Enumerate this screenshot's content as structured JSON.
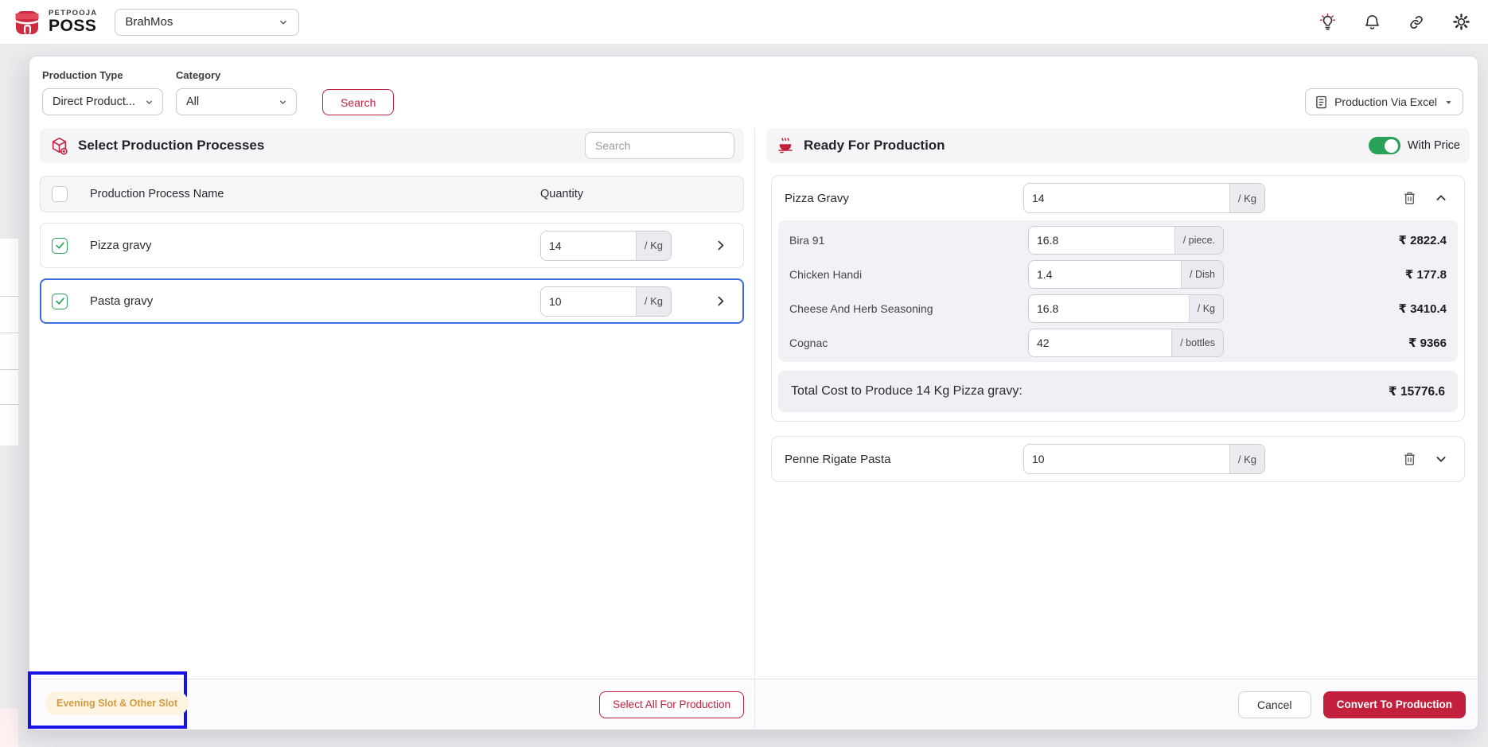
{
  "topbar": {
    "brand": {
      "top": "PETPOOJA",
      "bottom": "POSS"
    },
    "outlet": {
      "value": "BrahMos"
    }
  },
  "filters": {
    "production_type_label": "Production Type",
    "production_type_value": "Direct Product...",
    "category_label": "Category",
    "category_value": "All",
    "search_button": "Search",
    "excel_button": "Production Via Excel"
  },
  "left_panel": {
    "title": "Select Production Processes",
    "search_placeholder": "Search",
    "columns": {
      "name": "Production Process Name",
      "qty": "Quantity"
    },
    "rows": [
      {
        "name": "Pizza gravy",
        "qty": "14",
        "unit": "/ Kg"
      },
      {
        "name": "Pasta gravy",
        "qty": "10",
        "unit": "/ Kg"
      }
    ],
    "slot_badge": "Evening Slot & Other Slot",
    "select_all_button": "Select All For Production"
  },
  "right_panel": {
    "title": "Ready For Production",
    "with_price_label": "With Price",
    "cards": [
      {
        "name": "Pizza Gravy",
        "qty": "14",
        "unit": "/ Kg",
        "ingredients": [
          {
            "name": "Bira 91",
            "qty": "16.8",
            "unit": "/ piece.",
            "price": "₹ 2822.4"
          },
          {
            "name": "Chicken Handi",
            "qty": "1.4",
            "unit": "/ Dish",
            "price": "₹ 177.8"
          },
          {
            "name": "Cheese And Herb Seasoning",
            "qty": "16.8",
            "unit": "/ Kg",
            "price": "₹ 3410.4"
          },
          {
            "name": "Cognac",
            "qty": "42",
            "unit": "/ bottles",
            "price": "₹ 9366"
          }
        ],
        "total_label": "Total Cost to Produce 14 Kg Pizza gravy:",
        "total_value": "₹ 15776.6"
      },
      {
        "name": "Penne Rigate Pasta",
        "qty": "10",
        "unit": "/ Kg"
      }
    ],
    "cancel_button": "Cancel",
    "convert_button": "Convert To Production"
  },
  "colors": {
    "accent": "#c2203c",
    "green": "#27a258",
    "highlight_blue": "#1713e8",
    "slot_text": "#d19b43"
  }
}
